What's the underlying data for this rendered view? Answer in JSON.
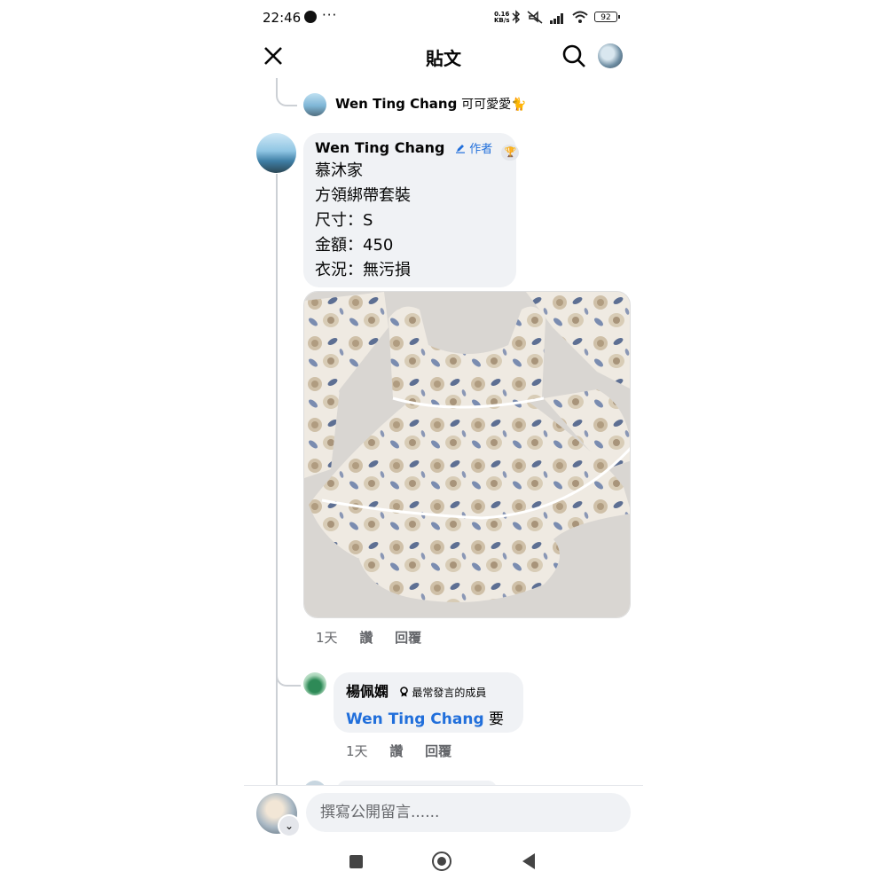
{
  "status_bar": {
    "time": "22:46",
    "speed_value": "0.16",
    "speed_unit": "KB/s",
    "battery": "92"
  },
  "header": {
    "title": "貼文"
  },
  "reply_preview": {
    "name": "Wen Ting Chang",
    "text": "可可愛愛🐈"
  },
  "comment": {
    "author": "Wen Ting Chang",
    "author_badge": "作者",
    "lines": [
      "慕沐家",
      "方領綁帶套裝",
      "尺寸：S",
      "金額：450",
      "衣況：無污損"
    ],
    "time": "1天",
    "like": "讚",
    "reply": "回覆"
  },
  "reply": {
    "author": "楊佩嫻",
    "rank_badge": "最常發言的成員",
    "mention": "Wen Ting Chang",
    "text": "要",
    "time": "1天",
    "like": "讚",
    "reply": "回覆"
  },
  "composer": {
    "placeholder": "撰寫公開留言......"
  },
  "colors": {
    "bubble": "#f0f2f5",
    "link": "#216fdb",
    "meta": "#65676b",
    "thread_line": "#ccd0d5"
  },
  "icons": [
    "messenger-icon",
    "bluetooth-icon",
    "mute-icon",
    "signal-icon",
    "wifi-icon",
    "battery-icon",
    "close-icon",
    "search-icon",
    "pencil-icon",
    "trophy-icon",
    "rank-icon",
    "chevron-down-icon",
    "nav-recents-icon",
    "nav-home-icon",
    "nav-back-icon"
  ]
}
